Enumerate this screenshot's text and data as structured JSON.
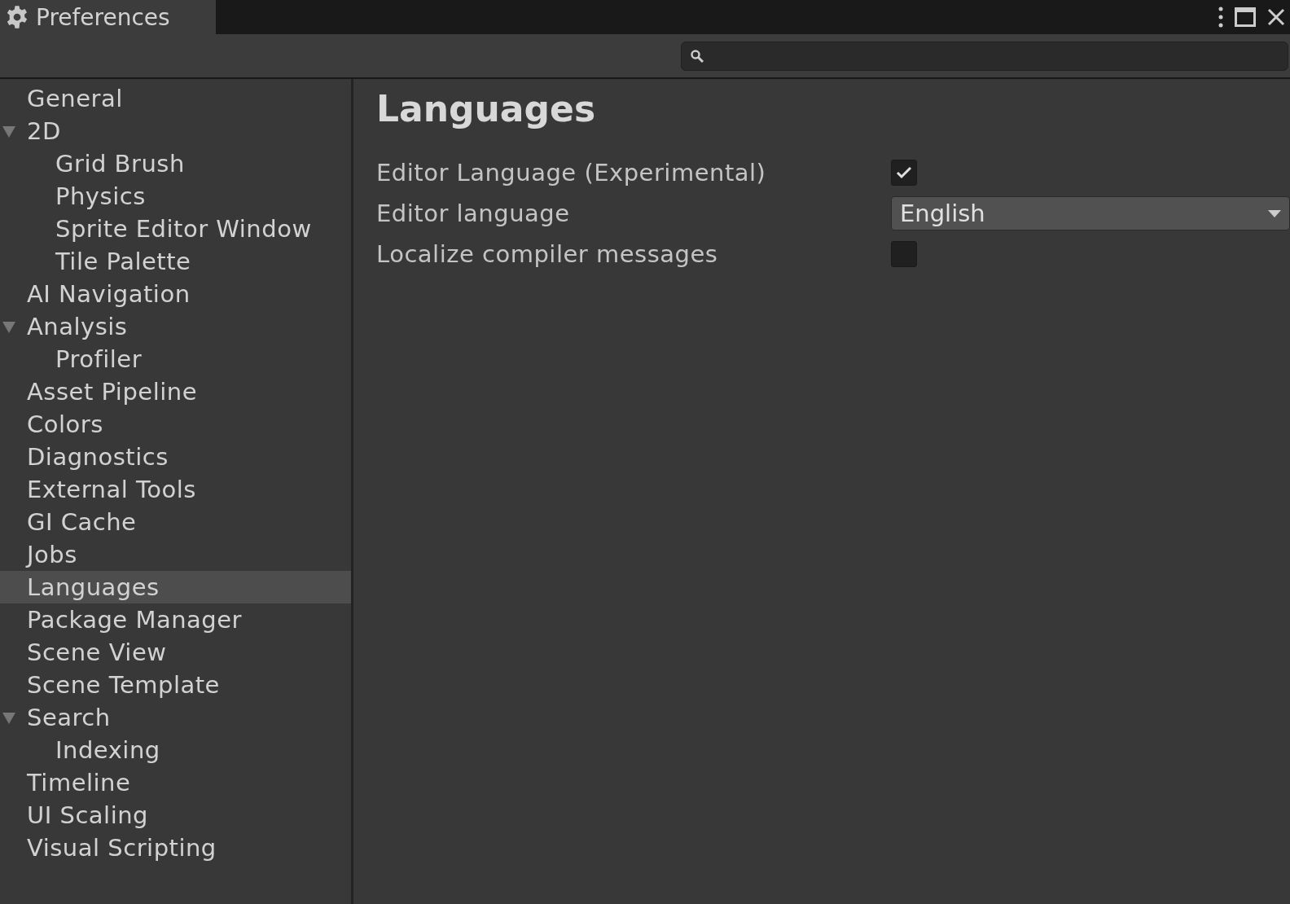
{
  "window": {
    "title": "Preferences"
  },
  "sidebar": {
    "items": [
      {
        "label": "General",
        "selected": false
      },
      {
        "label": "2D",
        "selected": false,
        "expanded": true,
        "children": [
          {
            "label": "Grid Brush",
            "selected": false
          },
          {
            "label": "Physics",
            "selected": false
          },
          {
            "label": "Sprite Editor Window",
            "selected": false
          },
          {
            "label": "Tile Palette",
            "selected": false
          }
        ]
      },
      {
        "label": "AI Navigation",
        "selected": false
      },
      {
        "label": "Analysis",
        "selected": false,
        "expanded": true,
        "children": [
          {
            "label": "Profiler",
            "selected": false
          }
        ]
      },
      {
        "label": "Asset Pipeline",
        "selected": false
      },
      {
        "label": "Colors",
        "selected": false
      },
      {
        "label": "Diagnostics",
        "selected": false
      },
      {
        "label": "External Tools",
        "selected": false
      },
      {
        "label": "GI Cache",
        "selected": false
      },
      {
        "label": "Jobs",
        "selected": false
      },
      {
        "label": "Languages",
        "selected": true
      },
      {
        "label": "Package Manager",
        "selected": false
      },
      {
        "label": "Scene View",
        "selected": false
      },
      {
        "label": "Scene Template",
        "selected": false
      },
      {
        "label": "Search",
        "selected": false,
        "expanded": true,
        "children": [
          {
            "label": "Indexing",
            "selected": false
          }
        ]
      },
      {
        "label": "Timeline",
        "selected": false
      },
      {
        "label": "UI Scaling",
        "selected": false
      },
      {
        "label": "Visual Scripting",
        "selected": false
      }
    ]
  },
  "panel": {
    "heading": "Languages",
    "settings": [
      {
        "kind": "checkbox",
        "label": "Editor Language (Experimental)",
        "checked": true
      },
      {
        "kind": "dropdown",
        "label": "Editor language",
        "value": "English"
      },
      {
        "kind": "checkbox",
        "label": "Localize compiler messages",
        "checked": false
      }
    ]
  }
}
